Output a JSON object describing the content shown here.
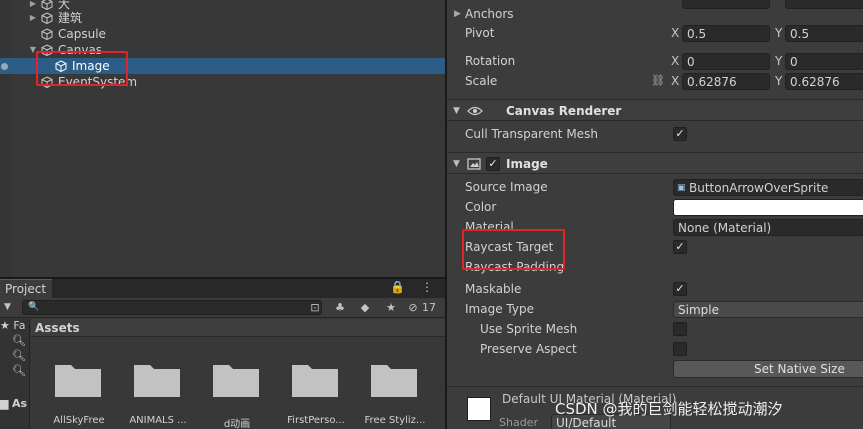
{
  "hierarchy": {
    "items": [
      {
        "label": "大",
        "expandable": true,
        "selected": false
      },
      {
        "label": "建筑",
        "expandable": true,
        "selected": false
      },
      {
        "label": "Capsule",
        "expandable": false,
        "selected": false
      },
      {
        "label": "Canvas",
        "expandable": true,
        "expanded": true,
        "selected": false
      },
      {
        "label": "Image",
        "expandable": false,
        "selected": true
      },
      {
        "label": "EventSystem",
        "expandable": false,
        "selected": false
      }
    ]
  },
  "project": {
    "tab_label": "Project",
    "tab_icons": "🔒 ⋮",
    "search": {
      "value": "",
      "placeholder": ""
    },
    "hidden_count": "17",
    "favorites_label": "Fa",
    "assets_root_label": "As",
    "assets_header": "Assets",
    "folders": [
      {
        "name": "AllSkyFree"
      },
      {
        "name": "ANIMALS ..."
      },
      {
        "name": "d动画"
      },
      {
        "name": "FirstPerso..."
      },
      {
        "name": "Free Styliz..."
      }
    ]
  },
  "inspector": {
    "rect_transform": {
      "anchors_label": "Anchors",
      "pivot_label": "Pivot",
      "pivot_x": "0.5",
      "pivot_y": "0.5",
      "rotation_label": "Rotation",
      "rotation_x": "0",
      "rotation_y": "0",
      "scale_label": "Scale",
      "scale_x": "0.62876",
      "scale_y": "0.62876",
      "x_axis": "X",
      "y_axis": "Y"
    },
    "canvas_renderer": {
      "title": "Canvas Renderer",
      "cull_label": "Cull Transparent Mesh",
      "cull_checked": true
    },
    "image": {
      "title": "Image",
      "enabled": true,
      "source_image_label": "Source Image",
      "source_image_value": "ButtonArrowOverSprite",
      "color_label": "Color",
      "color_value": "#ffffff",
      "material_label": "Material",
      "material_value": "None (Material)",
      "raycast_target_label": "Raycast Target",
      "raycast_target_checked": true,
      "raycast_padding_label": "Raycast Padding",
      "maskable_label": "Maskable",
      "maskable_checked": true,
      "image_type_label": "Image Type",
      "image_type_value": "Simple",
      "use_sprite_mesh_label": "Use Sprite Mesh",
      "preserve_aspect_label": "Preserve Aspect",
      "set_native_size_label": "Set Native Size"
    },
    "material_preview": {
      "name": "Default UI Material (Material)",
      "shader_label": "Shader",
      "shader_value": "UI/Default"
    }
  },
  "watermark": "CSDN @我的巨剑能轻松搅动潮汐",
  "colors": {
    "selection": "#2c5d87",
    "annotation_red": "#e0242b",
    "panel_bg": "#383838",
    "inspector_bg": "#3c3c3c"
  }
}
